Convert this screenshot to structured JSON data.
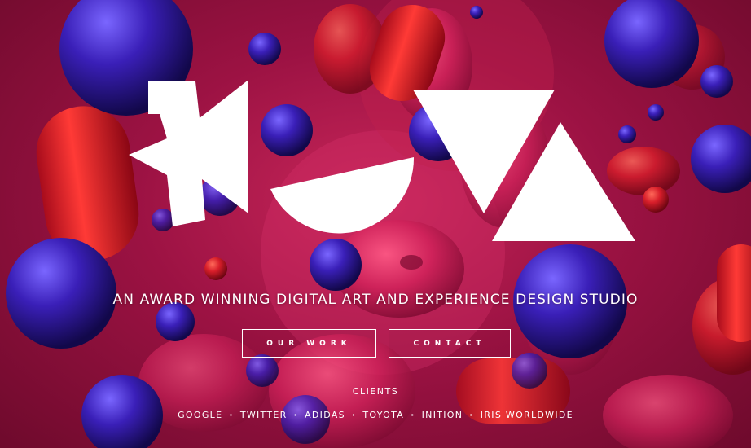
{
  "hero": {
    "tagline": "AN AWARD WINNING DIGITAL ART AND EXPERIENCE DESIGN STUDIO"
  },
  "buttons": {
    "our_work": "OUR WORK",
    "contact": "CONTACT"
  },
  "clients": {
    "heading": "CLIENTS",
    "separator": "·",
    "items": [
      "GOOGLE",
      "TWITTER",
      "ADIDAS",
      "TOYOTA",
      "INITION",
      "IRIS WORLDWIDE"
    ]
  },
  "colors": {
    "background": "#9c1243",
    "sphere_blue": "#3a1fb8",
    "sphere_red": "#d81e2a",
    "logo": "#ffffff",
    "text": "#ffffff"
  }
}
